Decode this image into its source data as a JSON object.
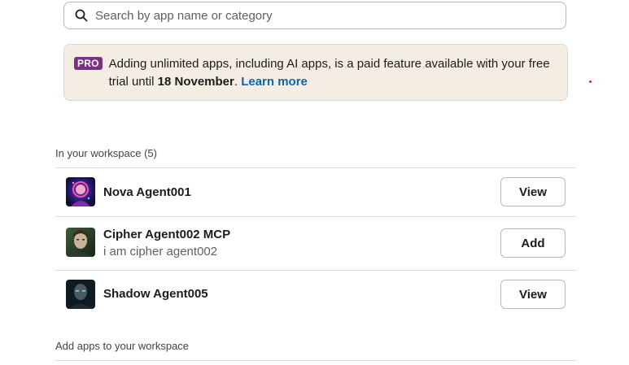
{
  "search": {
    "placeholder": "Search by app name or category",
    "icon": "search-icon"
  },
  "banner": {
    "badge": "PRO",
    "text_before": "Adding unlimited apps, including AI apps, is a paid feature available with your free trial until ",
    "date": "18 November",
    "text_after": ". ",
    "link": "Learn more",
    "colors": {
      "background": "#f4ede4",
      "badge": "#7c3085",
      "link": "#1264a3"
    }
  },
  "workspace_section": {
    "label": "In your workspace (5)",
    "apps": [
      {
        "name": "Nova Agent001",
        "description": "",
        "button": "View"
      },
      {
        "name": "Cipher Agent002 MCP",
        "description": "i am cipher agent002",
        "button": "Add"
      },
      {
        "name": "Shadow Agent005",
        "description": "",
        "button": "View"
      }
    ]
  },
  "add_section": {
    "label": "Add apps to your workspace"
  }
}
